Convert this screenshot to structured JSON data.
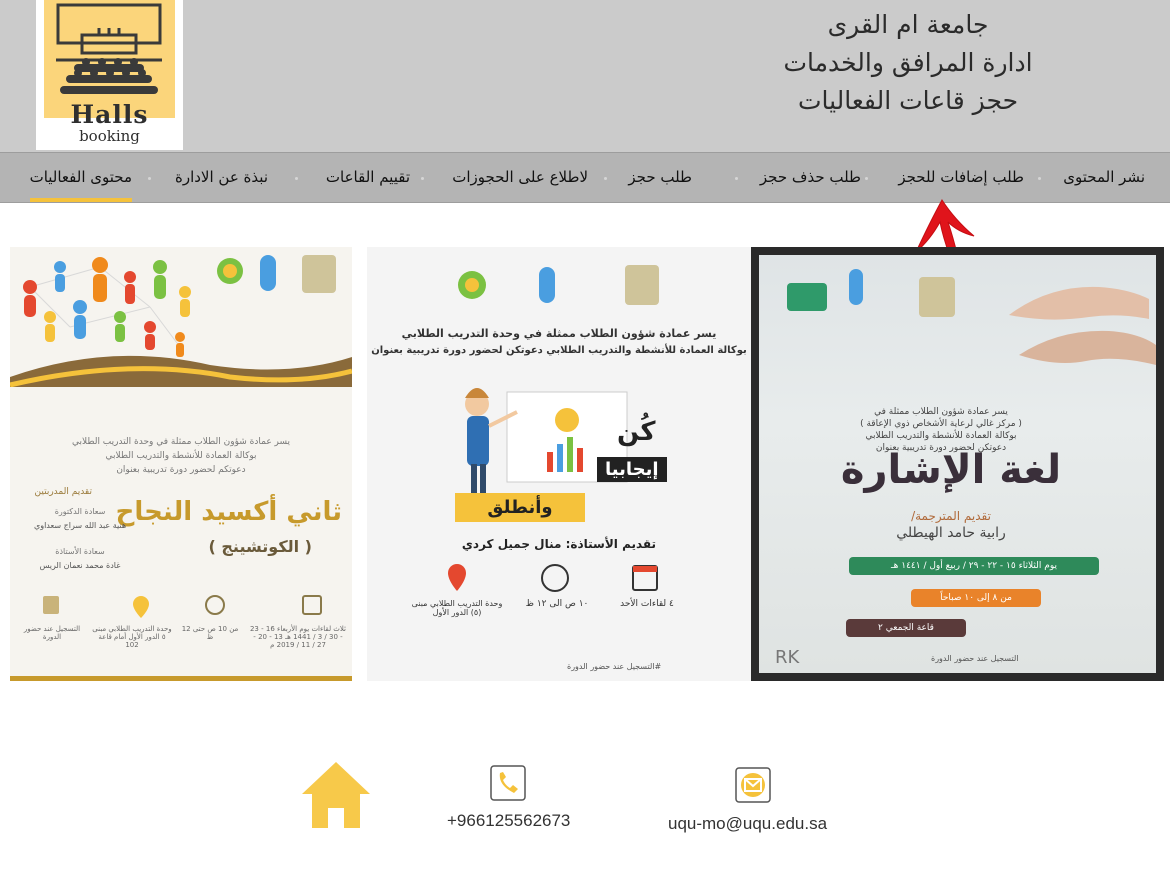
{
  "logo": {
    "title": "Halls",
    "subtitle": "booking"
  },
  "header": {
    "line1": "جامعة ام القرى",
    "line2": "ادارة المرافق والخدمات",
    "line3": "حجز قاعات الفعاليات"
  },
  "nav": {
    "items": [
      "نشر المحتوى",
      "طلب إضافات للحجز",
      "طلب حذف حجز",
      "طلب حجز",
      "لاطلاع على الحجوزات",
      "تقييم القاعات",
      "نبذة عن الادارة",
      "محتوى الفعاليات"
    ],
    "active_index": 7
  },
  "posters": {
    "left": {
      "intro": "يسر عمادة شؤون الطلاب ممثلة في وحدة التدريب الطلابي",
      "intro2": "بوكالة العمادة للأنشطة والتدريب الطلابي",
      "intro3": "دعوتكم لحضور دورة تدريبية بعنوان",
      "presenters": "تقديم المدربتين",
      "title": "ثاني أكسيد النجاح",
      "subtitle": "( الكوتشينج )",
      "p1_role": "سعادة الدكتورة",
      "p1_name": "هنية عبد الله سراج سعداوي",
      "p2_role": "سعادة الأستاذة",
      "p2_name": "غادة محمد نعمان الريس",
      "c1": "التسجيل عند حضور الدورة",
      "c2": "وحدة التدريب الطلابي مبنى ٥ الدور الأول أمام قاعة 102",
      "c3": "من 10 ص حتى 12 ظ",
      "c4": "ثلاث لقاءات يوم الأربعاء 16 - 23 - 30 / 3 / 1441 هـ 13 - 20 - 27 / 11 / 2019 م"
    },
    "middle": {
      "intro": "يسر عمادة شؤون الطلاب ممثلة في وحدة التدريب الطلابي",
      "intro2": "بوكالة العمادة للأنشطة والتدريب الطلابي دعوتكن لحضور دورة تدريبية بعنوان",
      "kun": "كُن",
      "ijabiya": "إيجابيا",
      "intalek": "وأنطلق",
      "presenter": "تقديم الأستاذة: منال جميل كردي",
      "d1": "٤ لقاءات الأحد",
      "d2": "١٠ ص الى ١٢ ظ",
      "d3": "وحدة التدريب الطلابي مبنى (٥) الدور الأول",
      "footer": "#التسجيل عند حضور الدورة"
    },
    "right": {
      "intro": "يسر عمادة شؤون الطلاب ممثلة في",
      "intro2": "( مركز غالي لرعاية الأشخاص ذوي الإعاقة )",
      "intro3": "بوكالة العمادة للأنشطة والتدريب الطلابي",
      "intro4": "دعوتكن لحضور دورة تدريبية بعنوان",
      "title": "لغة الإشارة",
      "presenter_label": "تقديم المترجمة/",
      "presenter": "رابية حامد الهيطلي",
      "date": "يوم الثلاثاء ١٥ - ٢٢ - ٢٩ / ربيع أول / ١٤٤١ هـ",
      "time": "من ٨ إلى ١٠ صباحاً",
      "place": "قاعة الجمعي ٢",
      "footer": "التسجيل عند حضور الدورة",
      "sign": "RK"
    }
  },
  "footer": {
    "phone": "+966125562673",
    "email": "uqu-mo@uqu.edu.sa"
  },
  "colors": {
    "header_bg": "#cbcbcb",
    "nav_bg": "#b4b4b4",
    "accent": "#f5c23b",
    "annotation_arrow": "#e0141b"
  }
}
